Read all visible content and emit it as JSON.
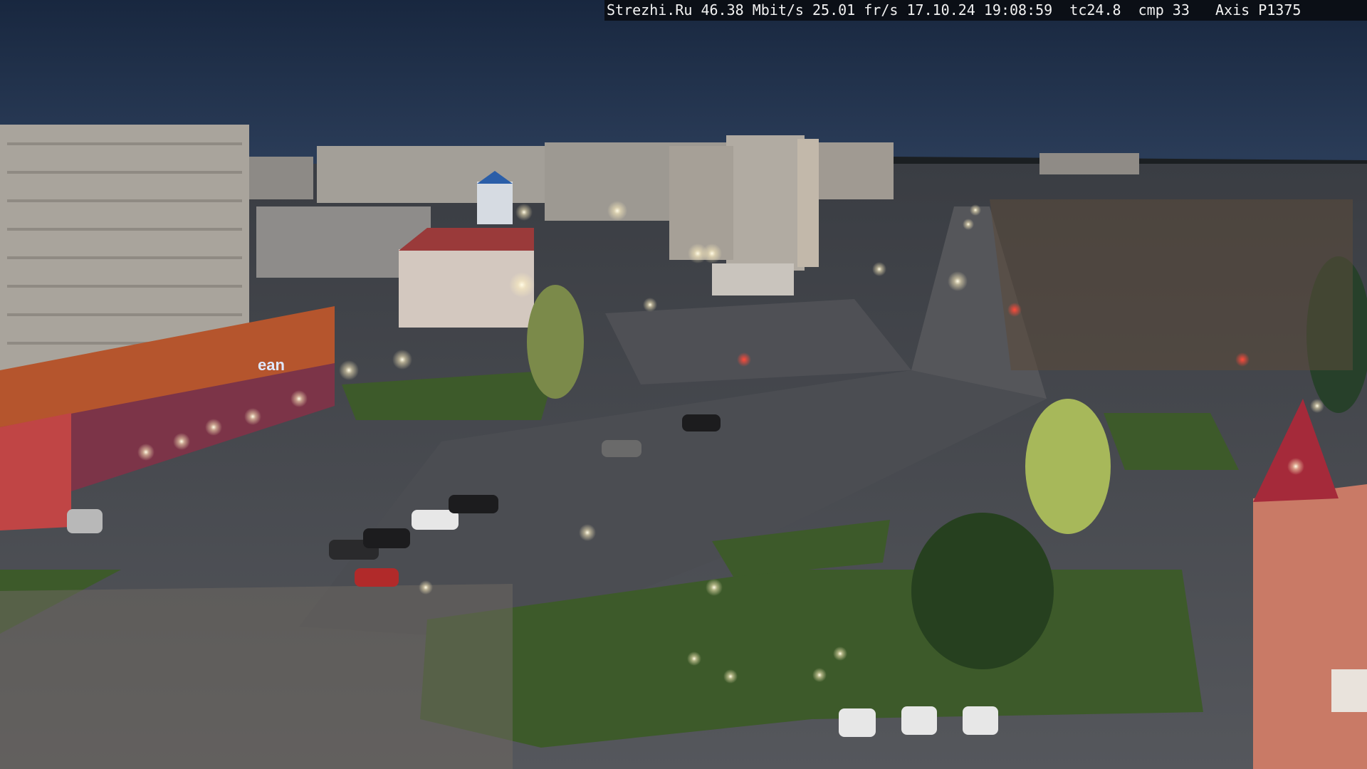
{
  "overlay": {
    "site": "Strezhi.Ru",
    "bitrate": "46.38 Mbit/s",
    "framerate": "25.01 fr/s",
    "date": "17.10.24",
    "time": "19:08:59",
    "tc": "tc24.8",
    "cmp": "cmp 33",
    "camera": "Axis P1375"
  },
  "signs": {
    "store": "ean"
  },
  "colors": {
    "sky_top": "#1a2a44",
    "sky_horizon": "#2b3d58",
    "road": "#4a4c52",
    "grass": "#3f5a2c",
    "lamp": "#fff6d8"
  }
}
